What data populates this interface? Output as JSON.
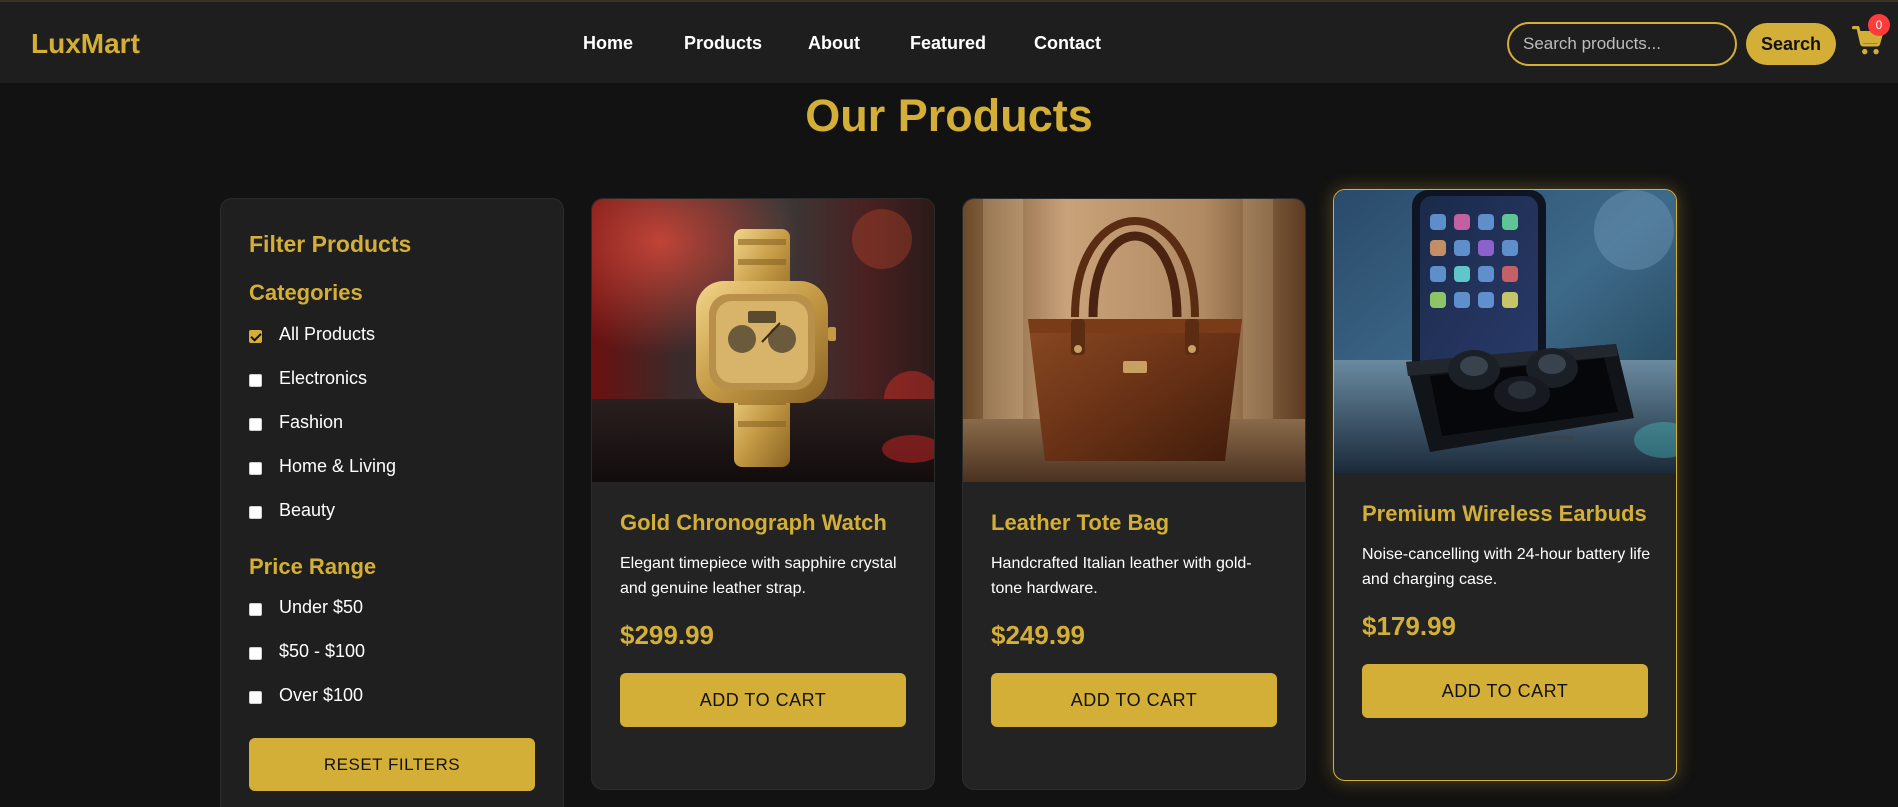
{
  "brand": {
    "name": "LuxMart",
    "accent_color": "#d4af37",
    "background_color": "#121212"
  },
  "nav": {
    "links": [
      "Home",
      "Products",
      "About",
      "Featured",
      "Contact"
    ]
  },
  "search": {
    "placeholder": "Search products...",
    "button_label": "Search"
  },
  "cart": {
    "icon": "cart-icon",
    "count": "0"
  },
  "page": {
    "title": "Our Products"
  },
  "filters": {
    "title": "Filter Products",
    "categories_title": "Categories",
    "categories": [
      {
        "label": "All Products",
        "checked": true
      },
      {
        "label": "Electronics",
        "checked": false
      },
      {
        "label": "Fashion",
        "checked": false
      },
      {
        "label": "Home & Living",
        "checked": false
      },
      {
        "label": "Beauty",
        "checked": false
      }
    ],
    "price_title": "Price Range",
    "price_ranges": [
      {
        "label": "Under $50",
        "checked": false
      },
      {
        "label": "$50 - $100",
        "checked": false
      },
      {
        "label": "Over $100",
        "checked": false
      }
    ],
    "reset_label": "RESET FILTERS"
  },
  "products": [
    {
      "name": "Gold Chronograph Watch",
      "description": "Elegant timepiece with sapphire crystal and genuine leather strap.",
      "price": "$299.99",
      "button_label": "ADD TO CART",
      "image": "gold-watch-image"
    },
    {
      "name": "Leather Tote Bag",
      "description": "Handcrafted Italian leather with gold-tone hardware.",
      "price": "$249.99",
      "button_label": "ADD TO CART",
      "image": "leather-bag-image"
    },
    {
      "name": "Premium Wireless Earbuds",
      "description": "Noise-cancelling with 24-hour battery life and charging case.",
      "price": "$179.99",
      "button_label": "ADD TO CART",
      "image": "earbuds-image",
      "featured": true
    }
  ]
}
